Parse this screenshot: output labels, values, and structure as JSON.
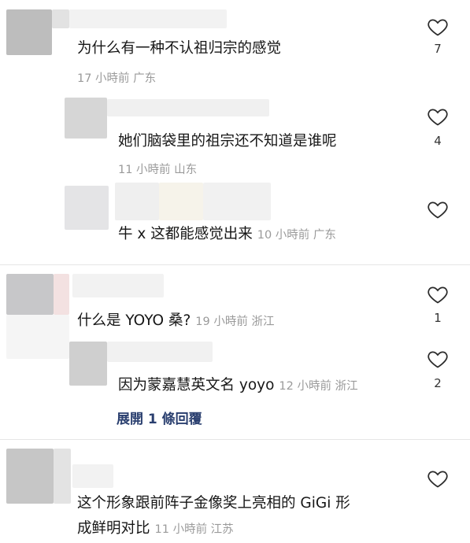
{
  "comments": [
    {
      "text": "为什么有一种不认祖归宗的感觉",
      "meta": "17 小時前  广东",
      "likes": "7"
    },
    {
      "text": "她们脑袋里的祖宗还不知道是谁呢",
      "meta": "11 小時前  山东",
      "likes": "4"
    },
    {
      "text": "牛 x 这都能感觉出来",
      "meta": "10 小時前  广东",
      "likes": ""
    },
    {
      "text": "什么是 YOYO 桑?",
      "meta": "19 小時前  浙江",
      "likes": "1"
    },
    {
      "text": "因为蒙嘉慧英文名 yoyo",
      "meta": "12 小時前  浙江",
      "likes": "2"
    },
    {
      "text_line1": "这个形象跟前阵子金像奖上亮相的 GiGi 形",
      "text_line2": "成鲜明对比",
      "meta": "11 小時前  江苏",
      "likes": ""
    }
  ],
  "expand_replies": "展開 1 條回覆",
  "icons": {
    "like": "heart-outline-icon"
  },
  "colors": {
    "text": "#161616",
    "meta": "#9a9a9a",
    "link": "#2a3f6f",
    "heart": "#2b2b2b"
  }
}
